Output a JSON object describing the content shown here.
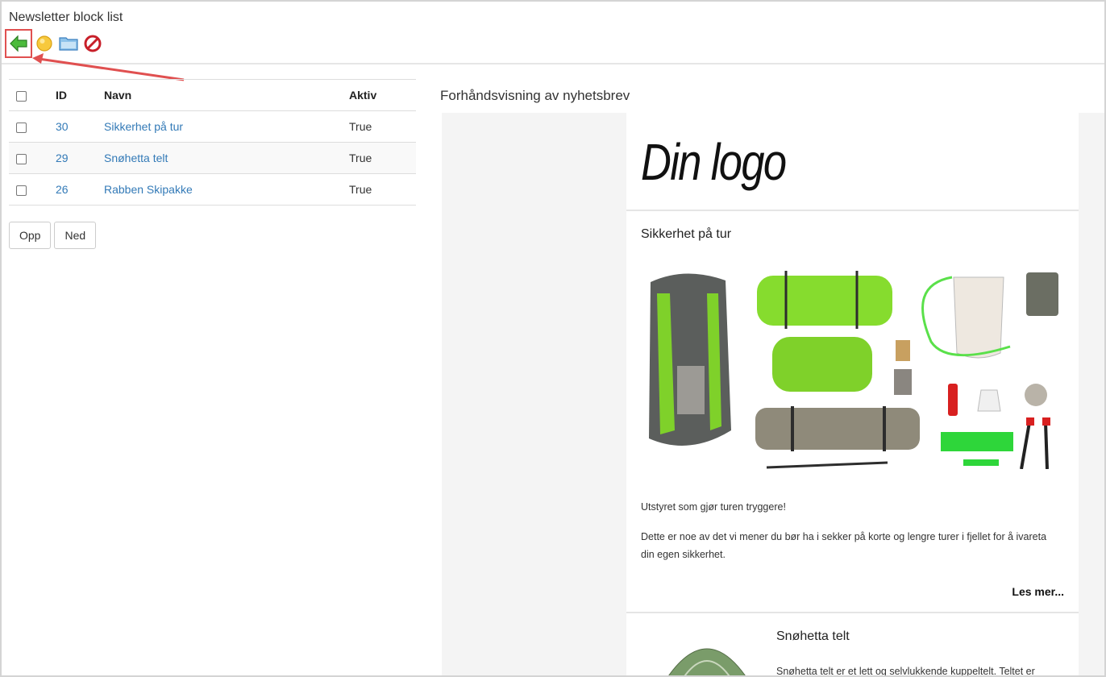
{
  "page": {
    "title": "Newsletter block list"
  },
  "toolbar": {
    "items": [
      {
        "icon": "back-arrow-icon",
        "color": "#3aa63a"
      },
      {
        "icon": "new-item-icon",
        "color": "#f3c43a"
      },
      {
        "icon": "folder-icon",
        "color": "#5d9fd6"
      },
      {
        "icon": "delete-icon",
        "color": "#c8202a"
      }
    ]
  },
  "table": {
    "headers": {
      "id": "ID",
      "name": "Navn",
      "active": "Aktiv"
    },
    "rows": [
      {
        "id": "30",
        "name": "Sikkerhet på tur",
        "active": "True"
      },
      {
        "id": "29",
        "name": "Snøhetta telt",
        "active": "True"
      },
      {
        "id": "26",
        "name": "Rabben Skipakke",
        "active": "True"
      }
    ]
  },
  "buttons": {
    "up": "Opp",
    "down": "Ned"
  },
  "preview": {
    "title": "Forhåndsvisning av nyhetsbrev",
    "logo": "Din logo",
    "article1": {
      "title": "Sikkerhet på tur",
      "lead": "Utstyret som gjør turen tryggere!",
      "body": "Dette er noe av det vi mener du bør ha i sekker på korte og lengre turer i fjellet for å ivareta din egen sikkerhet.",
      "read_more": "Les mer..."
    },
    "article2": {
      "title": "Snøhetta telt",
      "body": "Snøhetta telt er et lett og selvlukkende kuppeltelt. Teltet er"
    }
  },
  "colors": {
    "link": "#337ab7",
    "highlight": "#e05050",
    "accent_green": "#7fd12a"
  }
}
